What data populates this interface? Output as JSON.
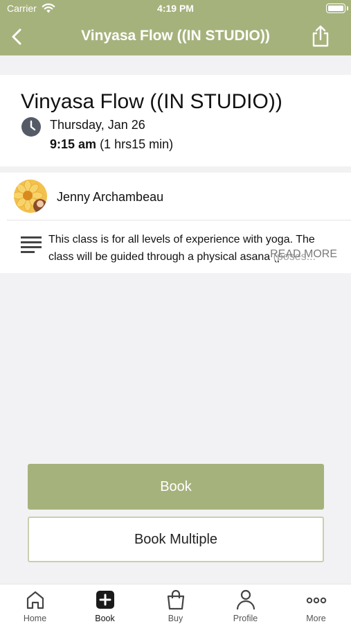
{
  "status": {
    "carrier": "Carrier",
    "time": "4:19 PM"
  },
  "nav": {
    "title": "Vinyasa Flow ((IN STUDIO))"
  },
  "class": {
    "title": "Vinyasa Flow ((IN STUDIO))",
    "date": "Thursday, Jan 26",
    "time": "9:15 am",
    "duration": "(1 hrs15 min)"
  },
  "instructor": {
    "name": "Jenny Archambeau"
  },
  "description": {
    "text": "This class is for all levels of experience with yoga. The class will be guided through a physical asana (poses...",
    "read_more": "READ MORE"
  },
  "actions": {
    "book": "Book",
    "book_multiple": "Book Multiple"
  },
  "tabs": [
    {
      "label": "Home",
      "icon": "home-icon"
    },
    {
      "label": "Book",
      "icon": "book-plus-icon",
      "active": true
    },
    {
      "label": "Buy",
      "icon": "shopping-bag-icon"
    },
    {
      "label": "Profile",
      "icon": "person-icon"
    },
    {
      "label": "More",
      "icon": "more-dots-icon"
    }
  ],
  "colors": {
    "accent": "#a6b27c",
    "background": "#f2f2f4"
  }
}
